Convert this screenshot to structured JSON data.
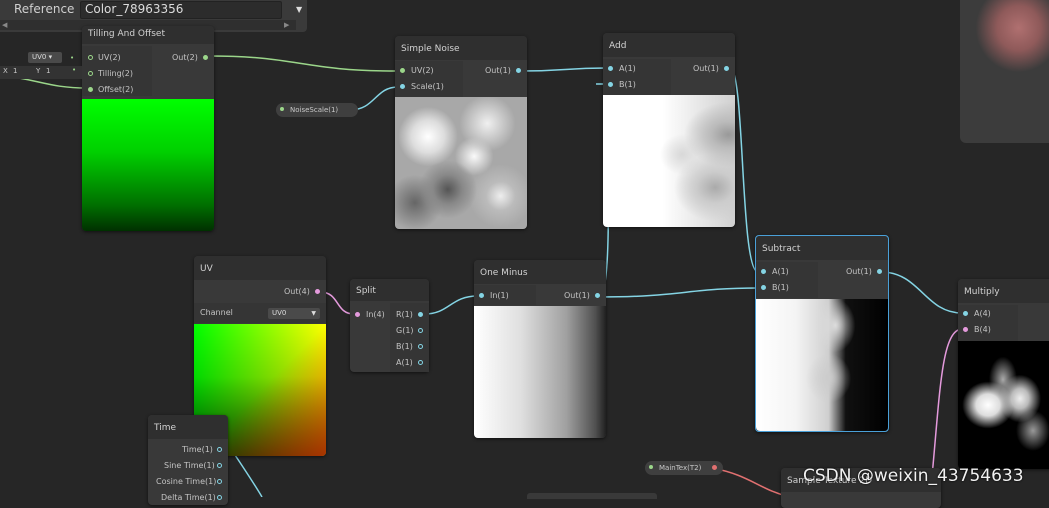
{
  "blackboard": {
    "label": "Reference",
    "value": "Color_78963356",
    "arrow": "▼"
  },
  "tilling": {
    "title": "Tilling And Offset",
    "inputs": [
      "UV(2)",
      "Tilling(2)",
      "Offset(2)"
    ],
    "output": "Out(2)",
    "uv_select": "UV0 ▾",
    "x_label": "X",
    "x_value": "1",
    "y_label": "Y",
    "y_value": "1"
  },
  "noise": {
    "title": "Simple Noise",
    "inputs": [
      "UV(2)",
      "Scale(1)"
    ],
    "output": "Out(1)",
    "scale_pill": "NoiseScale(1)"
  },
  "add": {
    "title": "Add",
    "inputs": [
      "A(1)",
      "B(1)"
    ],
    "output": "Out(1)"
  },
  "uv": {
    "title": "UV",
    "output": "Out(4)",
    "channel_label": "Channel",
    "channel_value": "UV0"
  },
  "split": {
    "title": "Split",
    "input": "In(4)",
    "outputs": [
      "R(1)",
      "G(1)",
      "B(1)",
      "A(1)"
    ]
  },
  "one_minus": {
    "title": "One Minus",
    "input": "In(1)",
    "output": "Out(1)"
  },
  "subtract": {
    "title": "Subtract",
    "inputs": [
      "A(1)",
      "B(1)"
    ],
    "output": "Out(1)"
  },
  "multiply": {
    "title": "Multiply",
    "inputs": [
      "A(4)",
      "B(4)"
    ]
  },
  "time": {
    "title": "Time",
    "outputs": [
      "Time(1)",
      "Sine Time(1)",
      "Cosine Time(1)",
      "Delta Time(1)"
    ]
  },
  "maintex_pill": "MainTex(T2)",
  "sample_title": "Sample Texture 2D",
  "watermark": "CSDN @weixin_43754633"
}
